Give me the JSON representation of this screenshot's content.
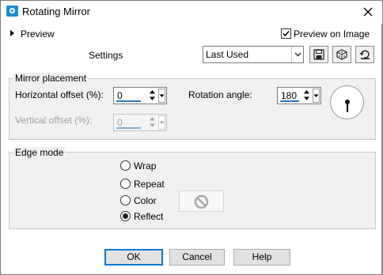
{
  "window": {
    "title": "Rotating Mirror",
    "close_icon": "close-icon",
    "app_icon": "camera-icon"
  },
  "preview": {
    "toggle_label": "Preview",
    "preview_on_image_label": "Preview on Image",
    "preview_on_image_checked": true
  },
  "settings": {
    "label": "Settings",
    "preset_value": "Last Used",
    "tool_icons": [
      "save-preset-icon",
      "randomize-icon",
      "reset-icon"
    ]
  },
  "mirror_placement": {
    "title": "Mirror placement",
    "horizontal_offset_label": "Horizontal offset (%):",
    "horizontal_offset_value": "0",
    "vertical_offset_label": "Vertical offset (%):",
    "vertical_offset_value": "0",
    "vertical_offset_enabled": false,
    "rotation_angle_label": "Rotation angle:",
    "rotation_angle_value": "180"
  },
  "edge_mode": {
    "title": "Edge mode",
    "options": [
      "Wrap",
      "Repeat",
      "Color",
      "Reflect"
    ],
    "selected": "Reflect",
    "color_swatch_icon": "no-color-icon"
  },
  "buttons": {
    "ok": "OK",
    "cancel": "Cancel",
    "help": "Help"
  },
  "colors": {
    "accent": "#0078d7",
    "underline": "#2b77c7",
    "group_background": "#f0f0f0"
  }
}
